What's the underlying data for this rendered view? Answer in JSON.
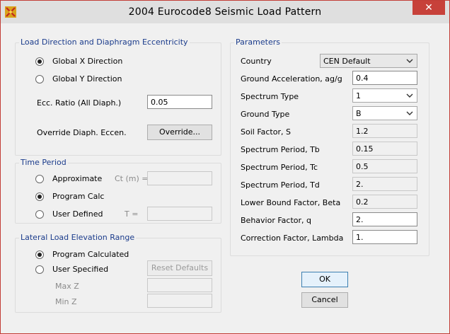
{
  "window": {
    "title": "2004 Eurocode8 Seismic Load Pattern",
    "close_glyph": "✕"
  },
  "load_direction": {
    "legend": "Load Direction and Diaphragm Eccentricity",
    "global_x_label": "Global  X  Direction",
    "global_y_label": "Global  Y  Direction",
    "selected": "global_x",
    "ecc_label": "Ecc. Ratio (All Diaph.)",
    "ecc_value": "0.05",
    "override_label": "Override Diaph. Eccen.",
    "override_button": "Override..."
  },
  "time_period": {
    "legend": "Time Period",
    "approximate_label": "Approximate",
    "ct_label": "Ct (m) =",
    "ct_value": "",
    "program_calc_label": "Program Calc",
    "user_defined_label": "User Defined",
    "t_label": "T =",
    "t_value": "",
    "selected": "program_calc"
  },
  "lateral_load": {
    "legend": "Lateral Load Elevation Range",
    "program_calculated_label": "Program Calculated",
    "user_specified_label": "User Specified",
    "selected": "program_calculated",
    "reset_button": "Reset Defaults",
    "max_z_label": "Max Z",
    "max_z_value": "",
    "min_z_label": "Min Z",
    "min_z_value": ""
  },
  "parameters": {
    "legend": "Parameters",
    "country_label": "Country",
    "country_value": "CEN Default",
    "ground_accel_label": "Ground Acceleration, ag/g",
    "ground_accel_value": "0.4",
    "spectrum_type_label": "Spectrum Type",
    "spectrum_type_value": "1",
    "ground_type_label": "Ground Type",
    "ground_type_value": "B",
    "soil_factor_label": "Soil Factor, S",
    "soil_factor_value": "1.2",
    "tb_label": "Spectrum Period, Tb",
    "tb_value": "0.15",
    "tc_label": "Spectrum Period, Tc",
    "tc_value": "0.5",
    "td_label": "Spectrum Period, Td",
    "td_value": "2.",
    "beta_label": "Lower Bound Factor, Beta",
    "beta_value": "0.2",
    "q_label": "Behavior Factor, q",
    "q_value": "2.",
    "lambda_label": "Correction Factor, Lambda",
    "lambda_value": "1."
  },
  "buttons": {
    "ok": "OK",
    "cancel": "Cancel"
  },
  "colors": {
    "legend": "#1a3b8b",
    "close": "#c7413a",
    "border": "#c23e37"
  }
}
